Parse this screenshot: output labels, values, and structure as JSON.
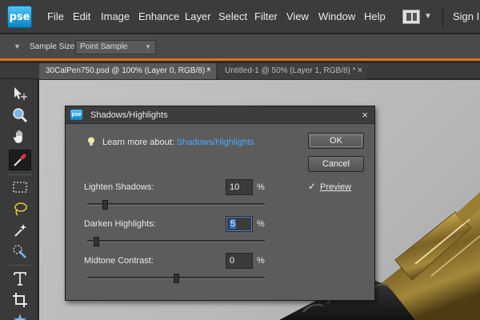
{
  "app": {
    "logo_text": "pse",
    "menu": [
      "File",
      "Edit",
      "Image",
      "Enhance",
      "Layer",
      "Select",
      "Filter",
      "View",
      "Window",
      "Help"
    ],
    "sign_in": "Sign In"
  },
  "options_bar": {
    "sample_size_label": "Sample Size:",
    "sample_size_value": "Point Sample"
  },
  "tabs": [
    {
      "label": "30CalPen750.psd @ 100% (Layer 0, RGB/8) *",
      "close": "×"
    },
    {
      "label": "Untitled-1 @ 50% (Layer 1, RGB/8) *",
      "close": "×"
    }
  ],
  "toolbox": {
    "tools": [
      "move-tool",
      "zoom-tool",
      "hand-tool",
      "eyedropper-tool",
      "marquee-tool",
      "lasso-tool",
      "magic-wand-tool",
      "quick-selection-tool",
      "type-tool",
      "crop-tool",
      "cookie-cutter-tool"
    ],
    "active_tool": "eyedropper-tool"
  },
  "dialog": {
    "title": "Shadows/Highlights",
    "logo_text": "pse",
    "close": "×",
    "learn_more_prefix": "Learn more about:",
    "learn_more_link": "Shadows/Highlights",
    "ok_label": "OK",
    "cancel_label": "Cancel",
    "preview_label": "Preview",
    "preview_checked": true,
    "sliders": [
      {
        "label": "Lighten Shadows:",
        "value": "10",
        "unit": "%",
        "position_percent": 10
      },
      {
        "label": "Darken Highlights:",
        "value": "5",
        "unit": "%",
        "position_percent": 5
      },
      {
        "label": "Midtone Contrast:",
        "value": "0",
        "unit": "%",
        "position_percent": 50
      }
    ]
  }
}
